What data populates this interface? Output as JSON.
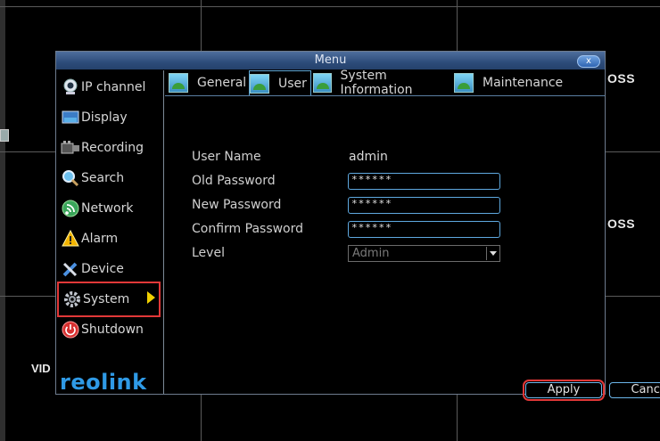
{
  "background": {
    "loss_labels": [
      "OSS",
      "OSS"
    ],
    "vid_label": "VID"
  },
  "menu": {
    "title": "Menu",
    "close_label": "x"
  },
  "sidebar": {
    "items": [
      {
        "label": "IP channel",
        "icon": "webcam-icon"
      },
      {
        "label": "Display",
        "icon": "monitor-icon"
      },
      {
        "label": "Recording",
        "icon": "film-icon"
      },
      {
        "label": "Search",
        "icon": "magnifier-icon"
      },
      {
        "label": "Network",
        "icon": "network-icon"
      },
      {
        "label": "Alarm",
        "icon": "warning-icon"
      },
      {
        "label": "Device",
        "icon": "tools-icon"
      },
      {
        "label": "System",
        "icon": "gear-icon",
        "active": true
      },
      {
        "label": "Shutdown",
        "icon": "power-icon"
      }
    ],
    "logo": "reolink"
  },
  "tabs": [
    {
      "label": "General"
    },
    {
      "label": "User",
      "selected": true
    },
    {
      "label": "System Information"
    },
    {
      "label": "Maintenance"
    }
  ],
  "form": {
    "user_name_label": "User Name",
    "user_name_value": "admin",
    "old_password_label": "Old Password",
    "old_password_value": "******",
    "new_password_label": "New Password",
    "new_password_value": "******",
    "confirm_password_label": "Confirm Password",
    "confirm_password_value": "******",
    "level_label": "Level",
    "level_value": "Admin"
  },
  "buttons": {
    "apply": "Apply",
    "cancel": "Cancel"
  },
  "colors": {
    "accent": "#5fa9e0",
    "highlight": "#e23838",
    "arrow": "#f0d000",
    "logo": "#2f9ae6"
  }
}
